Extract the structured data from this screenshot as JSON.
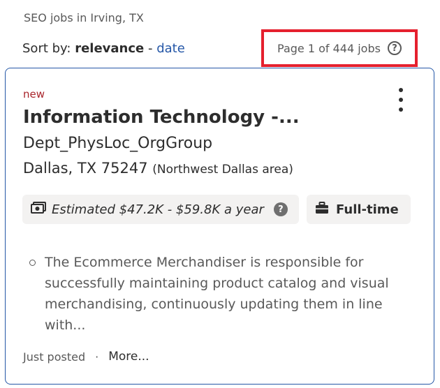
{
  "search_context": "SEO jobs in Irving, TX",
  "sort": {
    "label": "Sort by:",
    "active": "relevance",
    "separator": " - ",
    "option": "date"
  },
  "pagination": {
    "text": "Page 1 of 444 jobs",
    "help_glyph": "?"
  },
  "job": {
    "badge": "new",
    "title": "Information Technology -...",
    "company": "Dept_PhysLoc_OrgGroup",
    "location": "Dallas, TX 75247",
    "location_area": "(Northwest Dallas area)",
    "salary": "Estimated $47.2K - $59.8K a year",
    "salary_help_glyph": "?",
    "job_type": "Full-time",
    "snippet": "The Ecommerce Merchandiser is responsible for successfully maintaining product catalog and visual merchandising, continuously updating them in line with...",
    "posted": "Just posted",
    "dot": "·",
    "more": "More..."
  },
  "icons": {
    "menu": "kebab-menu-icon",
    "salary": "money-icon",
    "job_type": "briefcase-icon",
    "help": "help-icon"
  },
  "colors": {
    "accent": "#2557a7",
    "highlight": "#e5202e",
    "new_badge": "#a9252b"
  }
}
